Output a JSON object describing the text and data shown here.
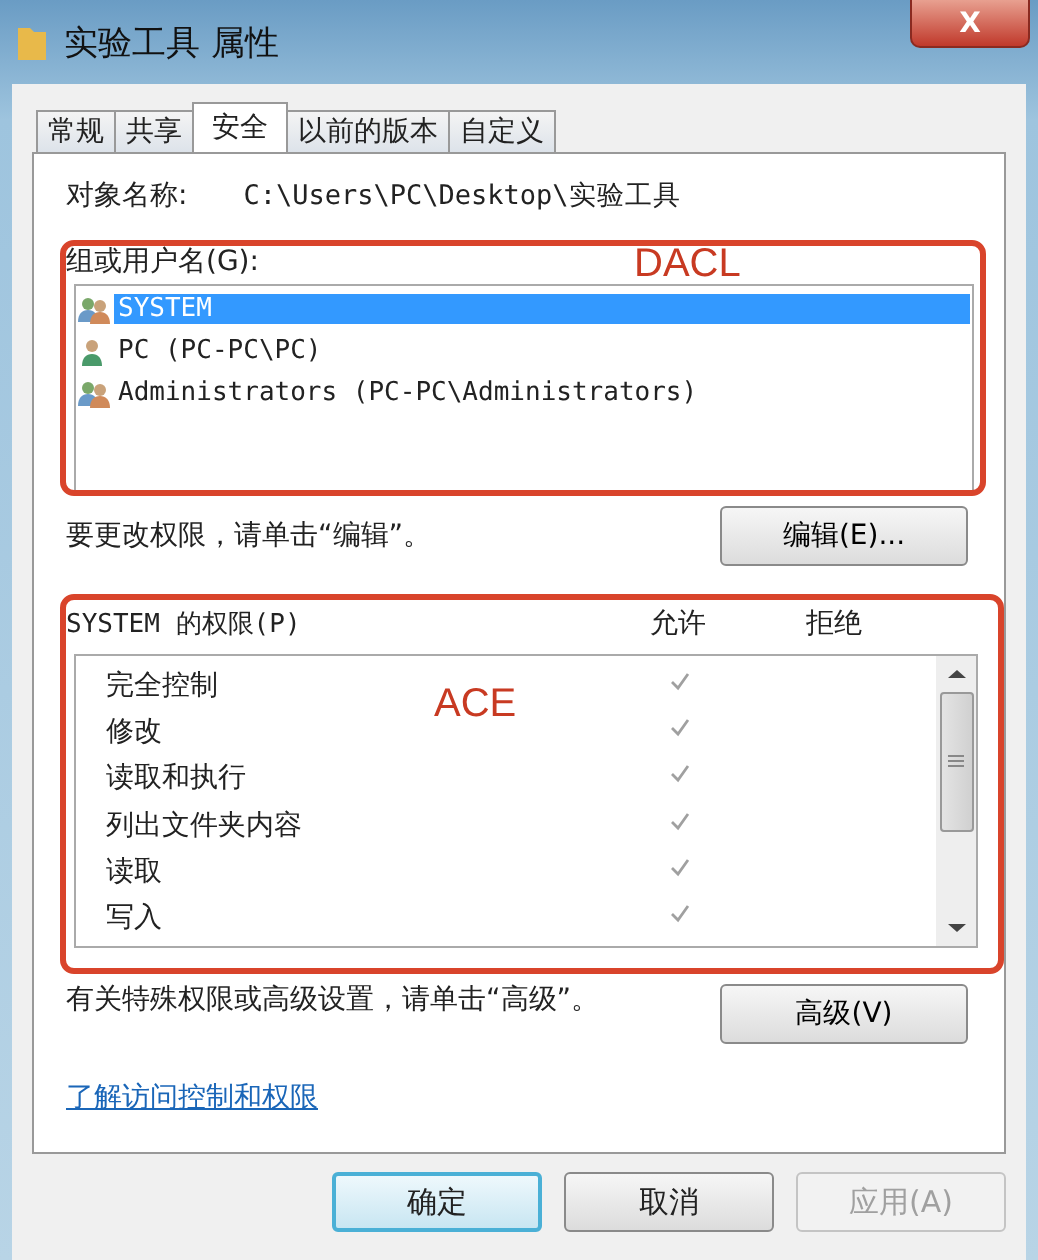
{
  "window": {
    "title": "实验工具 属性",
    "close": "X"
  },
  "tabs": [
    {
      "label": "常规",
      "selected": false
    },
    {
      "label": "共享",
      "selected": false
    },
    {
      "label": "安全",
      "selected": true
    },
    {
      "label": "以前的版本",
      "selected": false
    },
    {
      "label": "自定义",
      "selected": false
    }
  ],
  "object_name": {
    "label": "对象名称:",
    "value": "C:\\Users\\PC\\Desktop\\实验工具"
  },
  "groups": {
    "label": "组或用户名(G):",
    "items": [
      {
        "kind": "group",
        "name": "SYSTEM",
        "selected": true
      },
      {
        "kind": "user",
        "name": "PC (PC-PC\\PC)",
        "selected": false
      },
      {
        "kind": "group",
        "name": "Administrators (PC-PC\\Administrators)",
        "selected": false
      }
    ]
  },
  "edit_hint": "要更改权限，请单击“编辑”。",
  "edit_button": "编辑(E)...",
  "permissions": {
    "label": "SYSTEM 的权限(P)",
    "allow_header": "允许",
    "deny_header": "拒绝",
    "rows": [
      {
        "name": "完全控制",
        "allow": true,
        "deny": false
      },
      {
        "name": "修改",
        "allow": true,
        "deny": false
      },
      {
        "name": "读取和执行",
        "allow": true,
        "deny": false
      },
      {
        "name": "列出文件夹内容",
        "allow": true,
        "deny": false
      },
      {
        "name": "读取",
        "allow": true,
        "deny": false
      },
      {
        "name": "写入",
        "allow": true,
        "deny": false
      }
    ]
  },
  "advanced_hint": "有关特殊权限或高级设置，请单击“高级”。",
  "advanced_button": "高级(V)",
  "help_link": "了解访问控制和权限",
  "annotations": [
    {
      "label": "DACL"
    },
    {
      "label": "ACE"
    }
  ],
  "buttons": [
    {
      "label": "确定",
      "disabled": false,
      "default": true
    },
    {
      "label": "取消",
      "disabled": false,
      "default": false
    },
    {
      "label": "应用(A)",
      "disabled": true,
      "default": false
    }
  ]
}
